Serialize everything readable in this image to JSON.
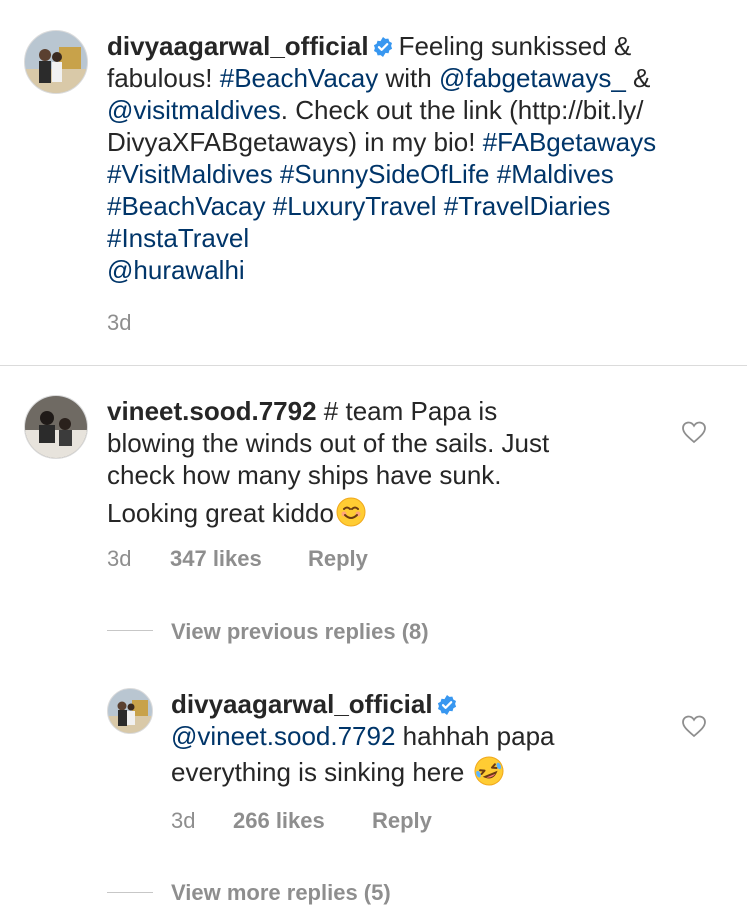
{
  "caption": {
    "username": "divyaagarwal_official",
    "lines": [
      {
        "segments": [
          {
            "t": "Feeling sunkissed &",
            "link": false
          }
        ]
      },
      {
        "segments": [
          {
            "t": "fabulous! ",
            "link": false
          },
          {
            "t": "#BeachVacay",
            "link": true
          },
          {
            "t": " with ",
            "link": false
          },
          {
            "t": "@fabgetaways_",
            "link": true
          },
          {
            "t": " &",
            "link": false
          }
        ]
      },
      {
        "segments": [
          {
            "t": "@visitmaldives",
            "link": true
          },
          {
            "t": ". Check out the link (http://bit.ly/",
            "link": false
          }
        ]
      },
      {
        "segments": [
          {
            "t": "DivyaXFABgetaways) in my bio! ",
            "link": false
          },
          {
            "t": "#FABgetaways",
            "link": true
          }
        ]
      },
      {
        "segments": [
          {
            "t": "#VisitMaldives #SunnySideOfLife #Maldives",
            "link": true
          }
        ]
      },
      {
        "segments": [
          {
            "t": "#BeachVacay #LuxuryTravel #TravelDiaries",
            "link": true
          }
        ]
      },
      {
        "segments": [
          {
            "t": "#InstaTravel",
            "link": true
          }
        ]
      },
      {
        "segments": [
          {
            "t": "@hurawalhi",
            "link": true
          }
        ]
      }
    ],
    "time": "3d"
  },
  "comment": {
    "username": "vineet.sood.7792",
    "first_line": "# team Papa is",
    "lines": [
      "blowing the winds out of the sails. Just",
      "check how many ships have sunk.",
      "Looking great kiddo"
    ],
    "emoji": "smiling-face-emoji",
    "time": "3d",
    "likes": "347 likes",
    "reply_label": "Reply",
    "view_previous": "View previous replies (8)"
  },
  "reply": {
    "username": "divyaagarwal_official",
    "mention": "@vineet.sood.7792",
    "first_line_rest": " hahhah papa",
    "second_line": "everything is sinking here",
    "emoji": "rolling-laughing-emoji",
    "time": "3d",
    "likes": "266 likes",
    "reply_label": "Reply",
    "view_more": "View more replies (5)"
  },
  "colors": {
    "link": "#003569",
    "verified": "#3897f0",
    "muted": "#8e8e8e"
  }
}
